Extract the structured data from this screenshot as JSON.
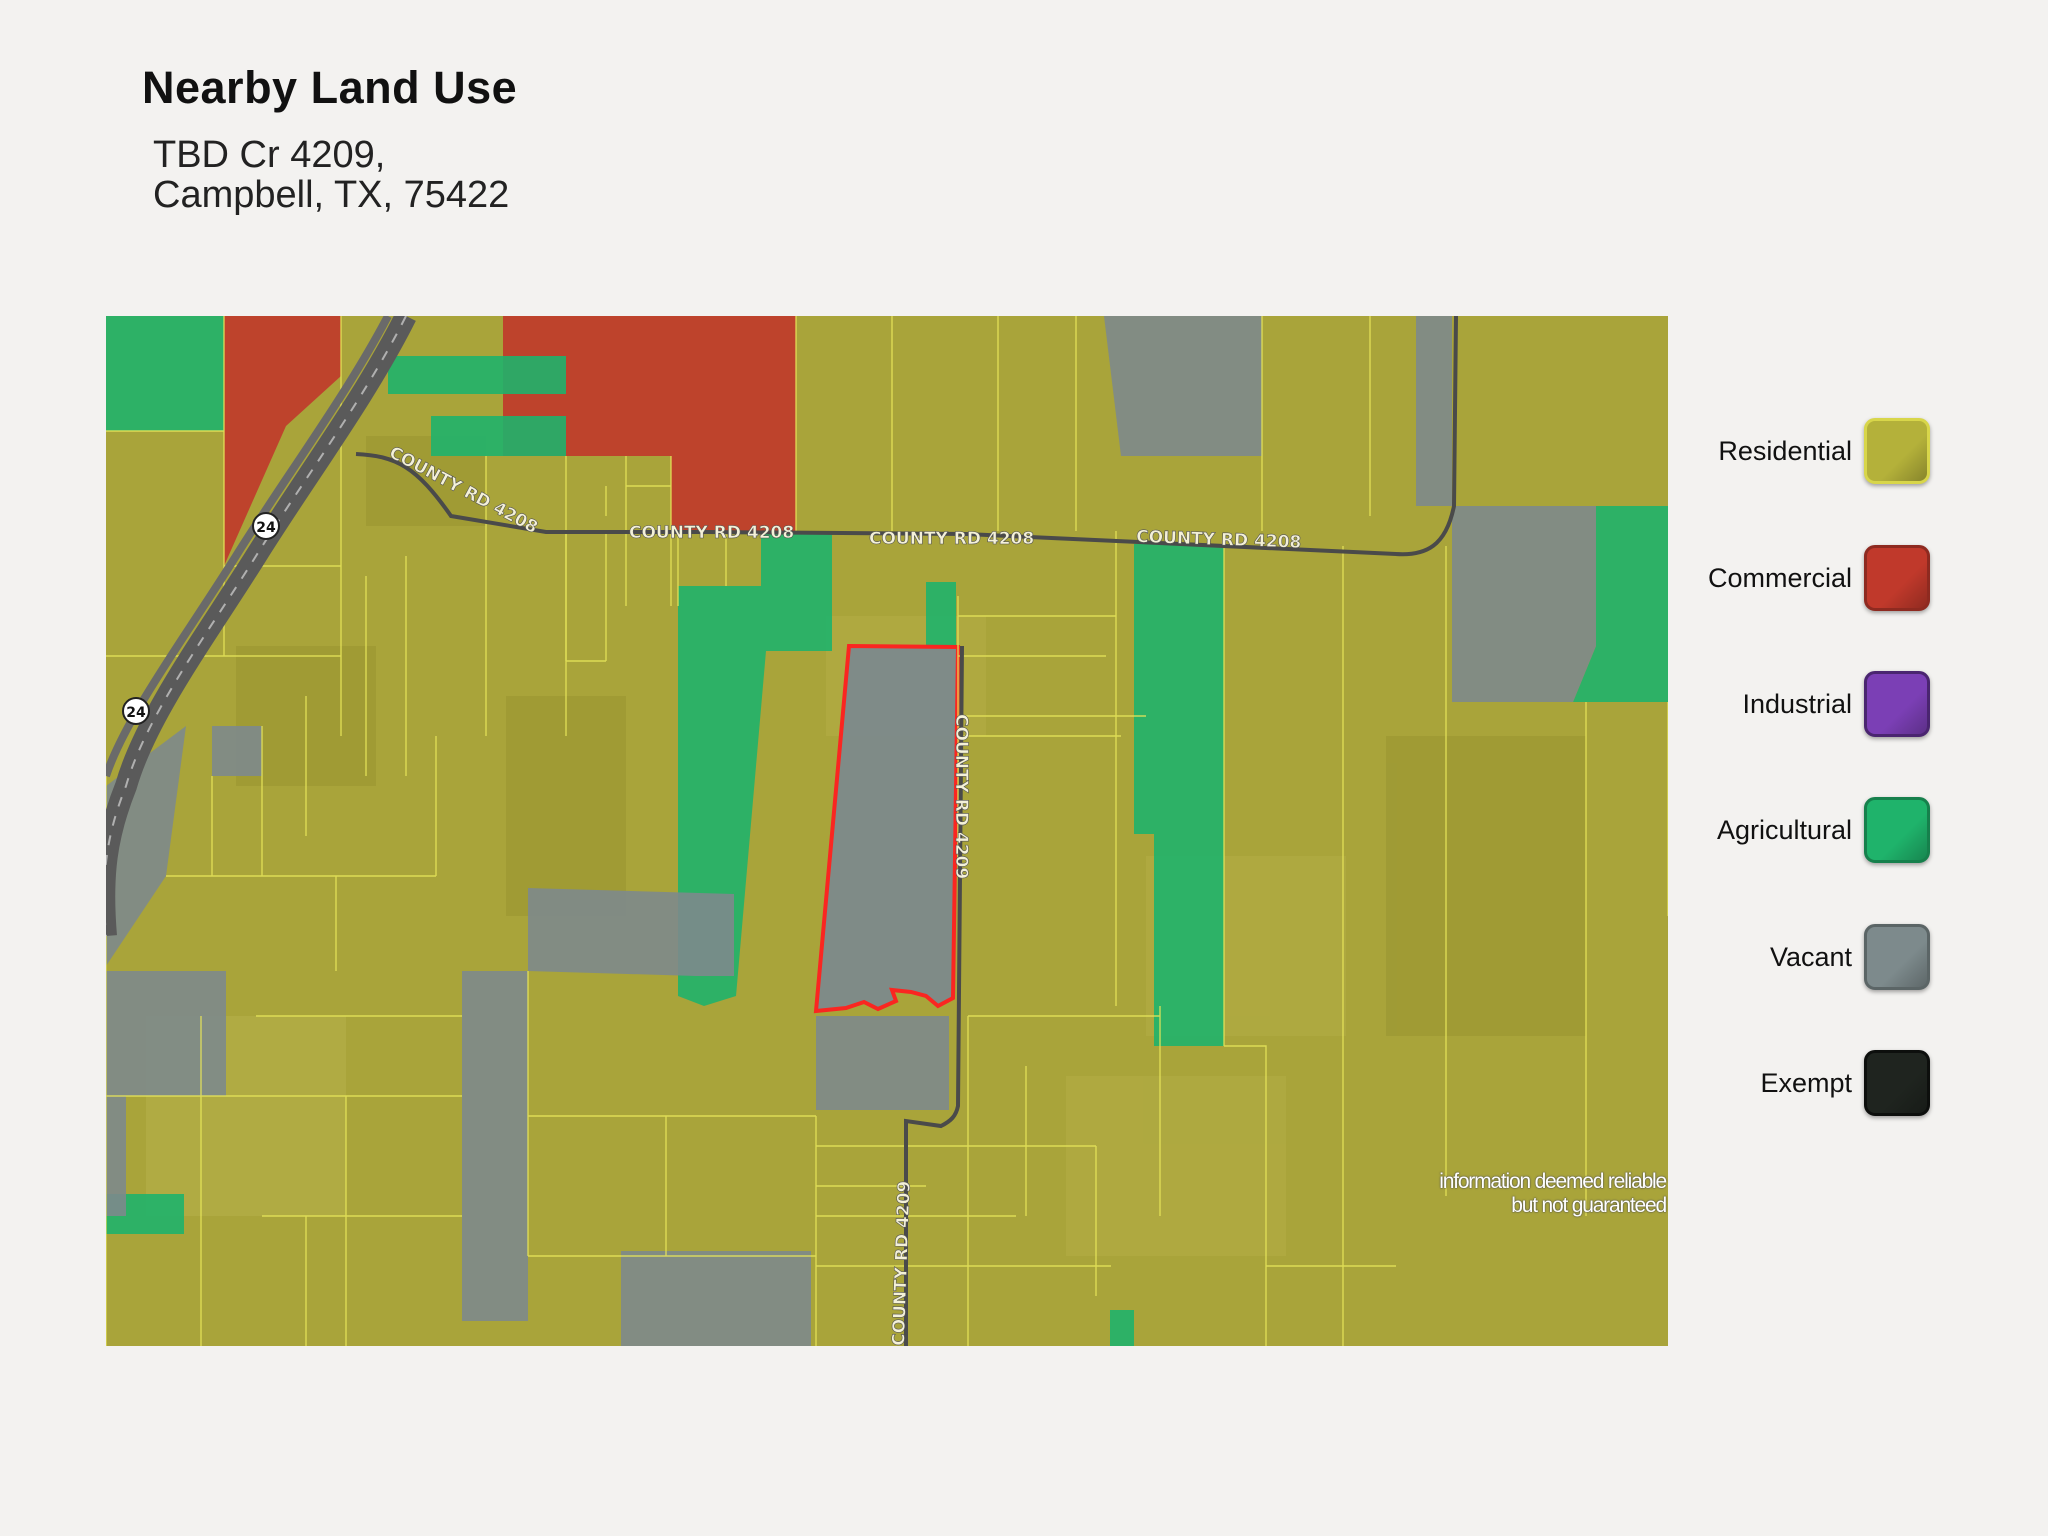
{
  "title": "Nearby Land Use",
  "address": {
    "line1": "TBD Cr 4209,",
    "line2": "Campbell, TX, 75422"
  },
  "legend": [
    {
      "label": "Residential",
      "color": "#b4b13a",
      "border": "#d8d64a"
    },
    {
      "label": "Commercial",
      "color": "#c0392b",
      "border": "#8e2a20"
    },
    {
      "label": "Industrial",
      "color": "#7b3fb5",
      "border": "#4a2570"
    },
    {
      "label": "Agricultural",
      "color": "#1fb36b",
      "border": "#16804c"
    },
    {
      "label": "Vacant",
      "color": "#7d8a8c",
      "border": "#5b6566"
    },
    {
      "label": "Exempt",
      "color": "#1f241f",
      "border": "#0d0f0d"
    }
  ],
  "map": {
    "roads": {
      "cr4208": "COUNTY RD 4208",
      "cr4209": "COUNTY RD 4209",
      "hwy": "24"
    },
    "subject_outline_color": "#ff2020"
  },
  "disclaimer": {
    "line1": "information deemed reliable",
    "line2": "but not guaranteed"
  }
}
